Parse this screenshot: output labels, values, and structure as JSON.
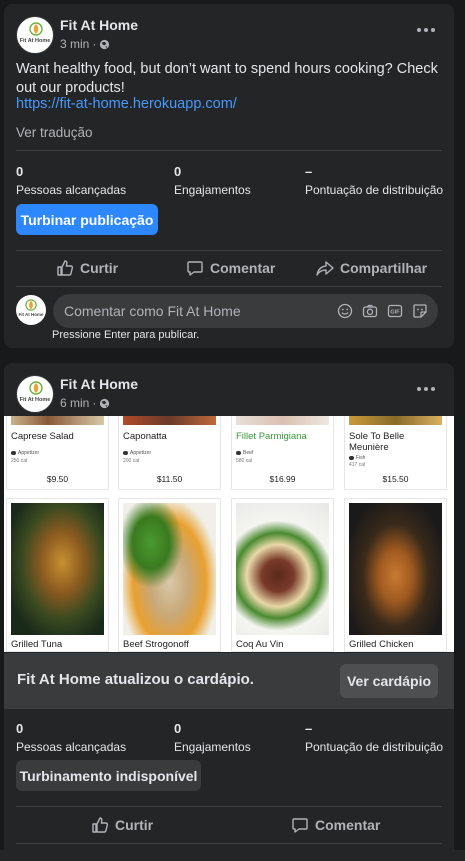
{
  "posts": [
    {
      "author": "Fit At Home",
      "time": "3 min",
      "text": "Want healthy food, but don’t want to spend hours cooking? Check out our products!",
      "link": "https://fit-at-home.herokuapp.com/",
      "see_translation": "Ver tradução",
      "stats": [
        {
          "num": "0",
          "label": "Pessoas alcançadas"
        },
        {
          "num": "0",
          "label": "Engajamentos"
        },
        {
          "num": "–",
          "label": "Pontuação de distribuição"
        }
      ],
      "boost_label": "Turbinar publicação",
      "actions": {
        "like": "Curtir",
        "comment": "Comentar",
        "share": "Compartilhar"
      },
      "comment_placeholder": "Comentar como Fit At Home",
      "comment_hint": "Pressione Enter para publicar."
    },
    {
      "author": "Fit At Home",
      "time": "6 min",
      "menu_top": [
        {
          "name": "Caprese Salad",
          "tag": "Appetizer",
          "cal": "250 cal",
          "price": "$9.50",
          "green": false
        },
        {
          "name": "Caponatta",
          "tag": "Appetizer",
          "cal": "200 cal",
          "price": "$11.50",
          "green": false
        },
        {
          "name": "Fillet Parmigiana",
          "tag": "Beef",
          "cal": "580 cal",
          "price": "$16.99",
          "green": true
        },
        {
          "name": "Sole To Belle Meunière",
          "tag": "Fish",
          "cal": "417 cal",
          "price": "$15.50",
          "green": false
        }
      ],
      "menu_bottom": [
        {
          "name": "Grilled Tuna"
        },
        {
          "name": "Beef Strogonoff"
        },
        {
          "name": "Coq Au Vin"
        },
        {
          "name": "Grilled Chicken"
        }
      ],
      "update_text": "Fit At Home atualizou o cardápio.",
      "see_menu_label": "Ver cardápio",
      "stats": [
        {
          "num": "0",
          "label": "Pessoas alcançadas"
        },
        {
          "num": "0",
          "label": "Engajamentos"
        },
        {
          "num": "–",
          "label": "Pontuação de distribuição"
        }
      ],
      "boost_label": "Turbinamento indisponível",
      "actions": {
        "like": "Curtir",
        "comment": "Comentar"
      }
    }
  ],
  "logo_text": "Fit At Home",
  "colors": {
    "background": "#18191a",
    "card": "#242526",
    "accent": "#2d88ff",
    "link": "#4599ff"
  },
  "icons": [
    "more-icon",
    "globe-icon",
    "like-icon",
    "comment-icon",
    "share-icon",
    "emoji-icon",
    "camera-icon",
    "gif-icon",
    "sticker-icon",
    "leaf-logo-icon"
  ]
}
